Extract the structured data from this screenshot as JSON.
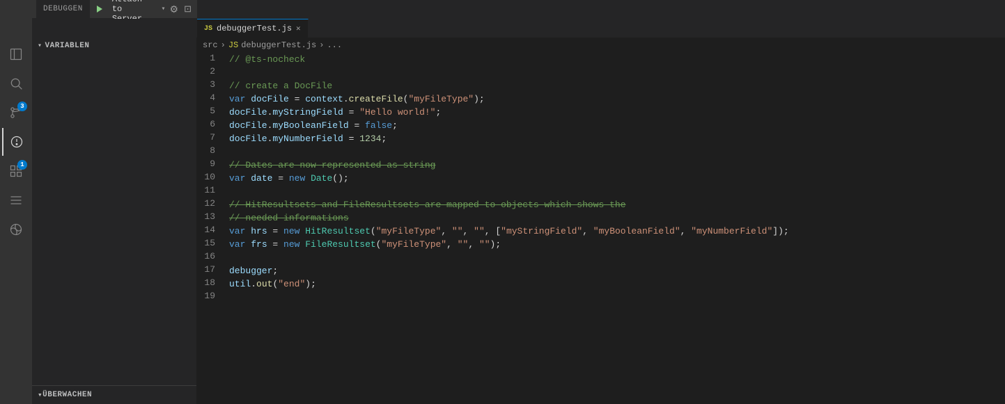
{
  "header": {
    "debug_label": "DEBUGGEN",
    "attach_label": "Attach to Server",
    "file_tab": "debuggerTest.js",
    "breadcrumb": {
      "src": "src",
      "sep1": "›",
      "js_label": "JS",
      "file": "debuggerTest.js",
      "sep2": "›",
      "dots": "..."
    }
  },
  "sidebar": {
    "variables_label": "VARIABLEN",
    "watch_label": "ÜBERWACHEN"
  },
  "activity": {
    "icons": [
      {
        "name": "explorer",
        "symbol": "⧉",
        "active": false,
        "badge": null
      },
      {
        "name": "search",
        "symbol": "🔍",
        "active": false,
        "badge": null
      },
      {
        "name": "source-control",
        "symbol": "⎇",
        "active": false,
        "badge": "3"
      },
      {
        "name": "debug",
        "symbol": "⊘",
        "active": true,
        "badge": null
      },
      {
        "name": "extensions",
        "symbol": "⊞",
        "active": false,
        "badge": "1"
      },
      {
        "name": "files",
        "symbol": "📁",
        "active": false,
        "badge": null
      },
      {
        "name": "remote",
        "symbol": "⊕",
        "active": false,
        "badge": null
      }
    ]
  },
  "code": {
    "lines": [
      {
        "num": 1,
        "tokens": [
          {
            "t": "comment",
            "v": "// @ts-nocheck"
          }
        ]
      },
      {
        "num": 2,
        "tokens": []
      },
      {
        "num": 3,
        "tokens": [
          {
            "t": "comment",
            "v": "// create a DocFile"
          }
        ]
      },
      {
        "num": 4,
        "tokens": [
          {
            "t": "keyword",
            "v": "var "
          },
          {
            "t": "var",
            "v": "docFile"
          },
          {
            "t": "plain",
            "v": " = "
          },
          {
            "t": "var",
            "v": "context"
          },
          {
            "t": "plain",
            "v": "."
          },
          {
            "t": "fn",
            "v": "createFile"
          },
          {
            "t": "plain",
            "v": "("
          },
          {
            "t": "string",
            "v": "\"myFileType\""
          },
          {
            "t": "plain",
            "v": ");"
          }
        ]
      },
      {
        "num": 5,
        "tokens": [
          {
            "t": "var",
            "v": "docFile"
          },
          {
            "t": "plain",
            "v": "."
          },
          {
            "t": "prop",
            "v": "myStringField"
          },
          {
            "t": "plain",
            "v": " = "
          },
          {
            "t": "string",
            "v": "\"Hello world!\""
          },
          {
            "t": "plain",
            "v": ";"
          }
        ]
      },
      {
        "num": 6,
        "tokens": [
          {
            "t": "var",
            "v": "docFile"
          },
          {
            "t": "plain",
            "v": "."
          },
          {
            "t": "prop",
            "v": "myBooleanField"
          },
          {
            "t": "plain",
            "v": " = "
          },
          {
            "t": "bool",
            "v": "false"
          },
          {
            "t": "plain",
            "v": ";"
          }
        ]
      },
      {
        "num": 7,
        "tokens": [
          {
            "t": "var",
            "v": "docFile"
          },
          {
            "t": "plain",
            "v": "."
          },
          {
            "t": "prop",
            "v": "myNumberField"
          },
          {
            "t": "plain",
            "v": " = "
          },
          {
            "t": "number",
            "v": "1234"
          },
          {
            "t": "plain",
            "v": ";"
          }
        ]
      },
      {
        "num": 8,
        "tokens": []
      },
      {
        "num": 9,
        "tokens": [
          {
            "t": "strike-comment",
            "v": "// Dates are now represented as string"
          }
        ]
      },
      {
        "num": 10,
        "tokens": [
          {
            "t": "keyword",
            "v": "var "
          },
          {
            "t": "var",
            "v": "date"
          },
          {
            "t": "plain",
            "v": " = "
          },
          {
            "t": "keyword",
            "v": "new "
          },
          {
            "t": "class",
            "v": "Date"
          },
          {
            "t": "plain",
            "v": "();"
          }
        ]
      },
      {
        "num": 11,
        "tokens": []
      },
      {
        "num": 12,
        "tokens": [
          {
            "t": "strike-comment",
            "v": "// HitResultsets and FileResultsets are mapped to objects which shows the"
          }
        ]
      },
      {
        "num": 13,
        "tokens": [
          {
            "t": "strike-comment",
            "v": "// needed informations"
          }
        ]
      },
      {
        "num": 14,
        "tokens": [
          {
            "t": "keyword",
            "v": "var "
          },
          {
            "t": "var",
            "v": "hrs"
          },
          {
            "t": "plain",
            "v": " = "
          },
          {
            "t": "keyword",
            "v": "new "
          },
          {
            "t": "class",
            "v": "HitResultset"
          },
          {
            "t": "plain",
            "v": "("
          },
          {
            "t": "string",
            "v": "\"myFileType\""
          },
          {
            "t": "plain",
            "v": ", "
          },
          {
            "t": "string",
            "v": "\"\""
          },
          {
            "t": "plain",
            "v": ", "
          },
          {
            "t": "string",
            "v": "\"\""
          },
          {
            "t": "plain",
            "v": ", ["
          },
          {
            "t": "string",
            "v": "\"myStringField\""
          },
          {
            "t": "plain",
            "v": ", "
          },
          {
            "t": "string",
            "v": "\"myBooleanField\""
          },
          {
            "t": "plain",
            "v": ", "
          },
          {
            "t": "string",
            "v": "\"myNumberField\""
          },
          {
            "t": "plain",
            "v": "]);"
          }
        ]
      },
      {
        "num": 15,
        "tokens": [
          {
            "t": "keyword",
            "v": "var "
          },
          {
            "t": "var",
            "v": "frs"
          },
          {
            "t": "plain",
            "v": " = "
          },
          {
            "t": "keyword",
            "v": "new "
          },
          {
            "t": "class",
            "v": "FileResultset"
          },
          {
            "t": "plain",
            "v": "("
          },
          {
            "t": "string",
            "v": "\"myFileType\""
          },
          {
            "t": "plain",
            "v": ", "
          },
          {
            "t": "string",
            "v": "\"\""
          },
          {
            "t": "plain",
            "v": ", "
          },
          {
            "t": "string",
            "v": "\"\""
          },
          {
            "t": "plain",
            "v": ");"
          }
        ]
      },
      {
        "num": 16,
        "tokens": []
      },
      {
        "num": 17,
        "tokens": [
          {
            "t": "var",
            "v": "debugger"
          },
          {
            "t": "plain",
            "v": ";"
          }
        ]
      },
      {
        "num": 18,
        "tokens": [
          {
            "t": "var",
            "v": "util"
          },
          {
            "t": "plain",
            "v": "."
          },
          {
            "t": "fn",
            "v": "out"
          },
          {
            "t": "plain",
            "v": "("
          },
          {
            "t": "string",
            "v": "\"end\""
          },
          {
            "t": "plain",
            "v": ");"
          }
        ]
      },
      {
        "num": 19,
        "tokens": []
      }
    ]
  }
}
